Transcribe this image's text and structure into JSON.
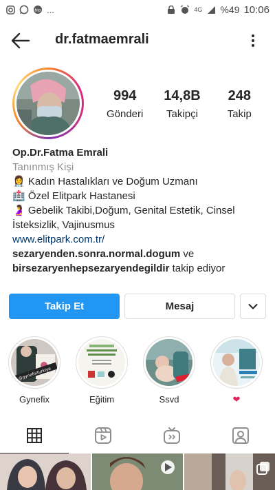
{
  "status_bar": {
    "left_dots": "...",
    "network": "4G",
    "battery": "%49",
    "time": "10:06"
  },
  "header": {
    "username": "dr.fatmaemrali"
  },
  "stats": [
    {
      "value": "994",
      "label": "Gönderi"
    },
    {
      "value": "14,8B",
      "label": "Takipçi"
    },
    {
      "value": "248",
      "label": "Takip"
    }
  ],
  "bio": {
    "name": "Op.Dr.Fatma Emrali",
    "category": "Tanınmış Kişi",
    "line1": "Kadın Hastalıkları ve Doğum Uzmanı",
    "line2": "Özel Elitpark Hastanesi",
    "line3": "Gebelik Takibi,Doğum, Genital Estetik, Cinsel İsteksizlik, Vajinusmus",
    "link": "www.elitpark.com.tr/",
    "followed_by_1": "sezaryenden.sonra.normal.dogum",
    "followed_by_and": "ve",
    "followed_by_2": "birsezaryenhepsezaryendegildir",
    "followed_by_suffix": "takip ediyor"
  },
  "buttons": {
    "follow": "Takip Et",
    "message": "Mesaj"
  },
  "highlights": [
    {
      "label": "Gynefix",
      "overlay": "@gynefixturkiye"
    },
    {
      "label": "Eğitim"
    },
    {
      "label": "Ssvd"
    },
    {
      "label": "❤"
    }
  ],
  "colors": {
    "follow_button": "#2196f3",
    "link": "#00376b",
    "category": "#8e8e8e",
    "heart": "#e0245e"
  }
}
